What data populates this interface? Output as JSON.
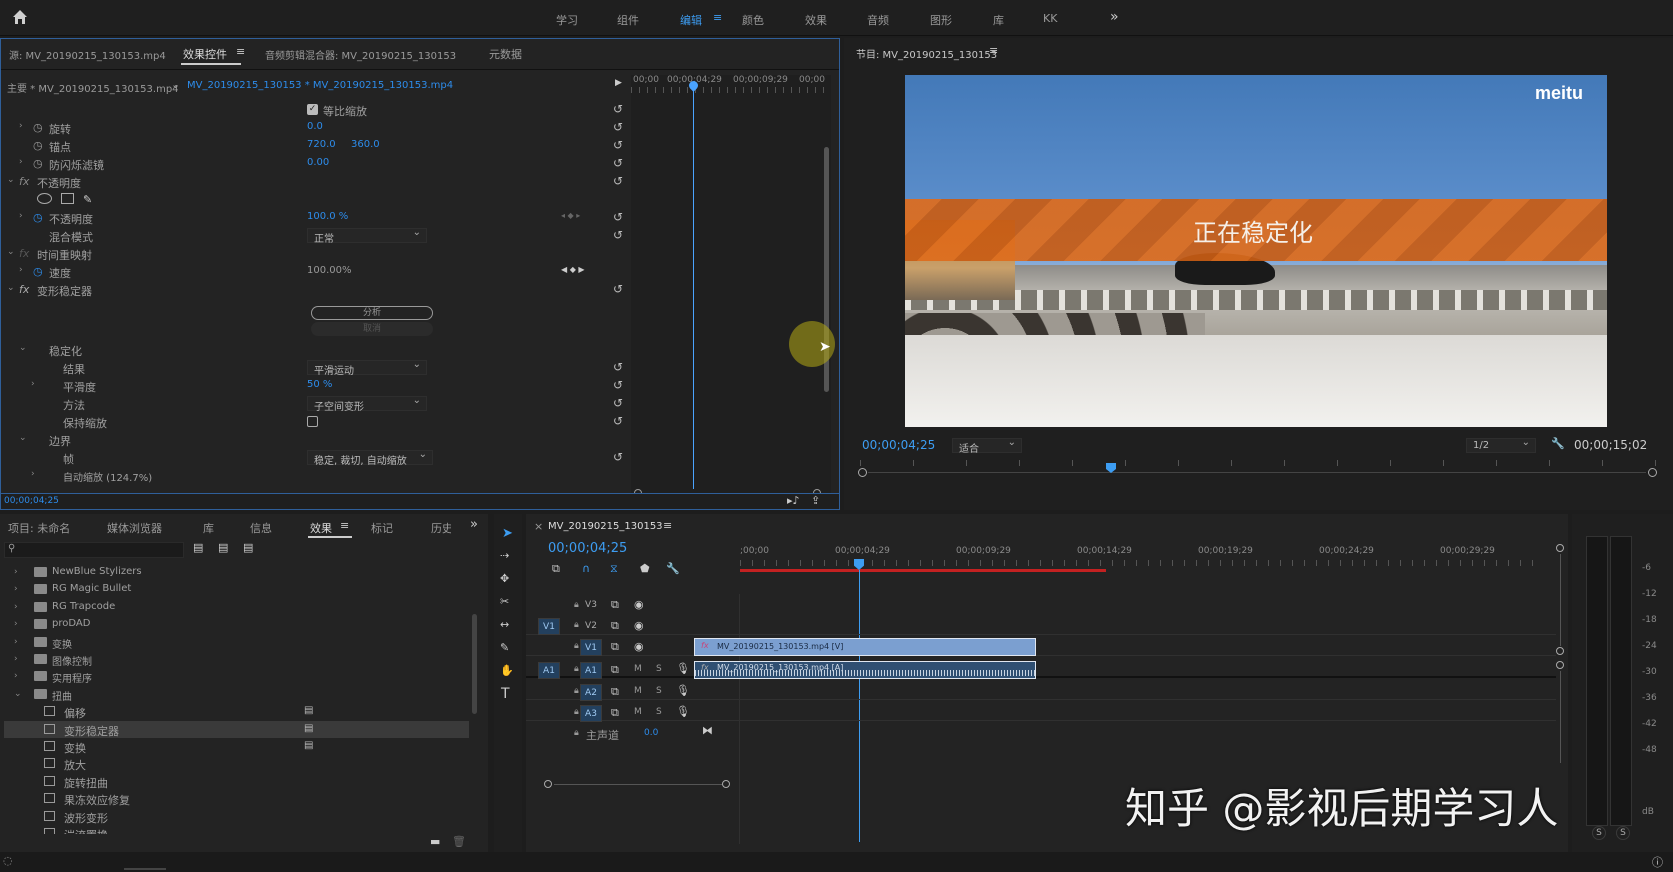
{
  "topbar": {
    "tabs": [
      "学习",
      "组件",
      "编辑",
      "颜色",
      "效果",
      "音频",
      "图形",
      "库",
      "KK"
    ],
    "active": "编辑",
    "more": "»"
  },
  "source_panel": {
    "tabs": [
      "源: MV_20190215_130153.mp4",
      "效果控件",
      "音频剪辑混合器: MV_20190215_130153",
      "元数据"
    ],
    "active_tab": "效果控件",
    "clip_master": "主要 * MV_20190215_130153.mp4",
    "clip_seq": "MV_20190215_130153 * MV_20190215_130153.mp4",
    "ruler": [
      "00;00",
      "00;00;04;29",
      "00;00;09;29",
      "00;00"
    ],
    "rows": {
      "uniform_scale": "等比缩放",
      "rotation": "旋转",
      "rotation_val": "0.0",
      "anchor": "锚点",
      "anchor_x": "720.0",
      "anchor_y": "360.0",
      "flicker": "防闪烁滤镜",
      "flicker_val": "0.00",
      "opacity_group": "不透明度",
      "opacity": "不透明度",
      "opacity_val": "100.0 %",
      "blend": "混合模式",
      "blend_val": "正常",
      "time_remap": "时间重映射",
      "speed": "速度",
      "speed_val": "100.00%",
      "warp": "变形稳定器",
      "analyze": "分析",
      "cancel": "取消",
      "stabilize": "稳定化",
      "result": "结果",
      "result_val": "平滑运动",
      "smoothness": "平滑度",
      "smoothness_val": "50 %",
      "method": "方法",
      "method_val": "子空间变形",
      "preserve": "保持缩放",
      "border": "边界",
      "framing": "帧",
      "framing_val": "稳定, 裁切, 自动缩放",
      "autoscale": "自动缩放 (124.7%)"
    },
    "timecode": "00;00;04;25"
  },
  "program": {
    "title": "节目: MV_20190215_130153",
    "logo": "meitu",
    "banner": "正在稳定化",
    "timecode": "00;00;04;25",
    "fit": "适合",
    "quality": "1/2",
    "duration": "00;00;15;02"
  },
  "project": {
    "tabs": [
      "项目: 未命名",
      "媒体浏览器",
      "库",
      "信息",
      "效果",
      "标记",
      "历史"
    ],
    "active_tab": "效果",
    "items": [
      {
        "name": "NewBlue Stylizers",
        "type": "folder"
      },
      {
        "name": "RG Magic Bullet",
        "type": "folder"
      },
      {
        "name": "RG Trapcode",
        "type": "folder"
      },
      {
        "name": "proDAD",
        "type": "folder"
      },
      {
        "name": "变换",
        "type": "folder"
      },
      {
        "name": "图像控制",
        "type": "folder"
      },
      {
        "name": "实用程序",
        "type": "folder"
      },
      {
        "name": "扭曲",
        "type": "folder",
        "open": true
      },
      {
        "name": "偏移",
        "type": "effect",
        "accel": true
      },
      {
        "name": "变形稳定器",
        "type": "effect",
        "accel": true,
        "selected": true
      },
      {
        "name": "变换",
        "type": "effect",
        "accel": true
      },
      {
        "name": "放大",
        "type": "effect"
      },
      {
        "name": "旋转扭曲",
        "type": "effect"
      },
      {
        "name": "果冻效应修复",
        "type": "effect"
      },
      {
        "name": "波形变形",
        "type": "effect"
      },
      {
        "name": "湍流置换",
        "type": "effect"
      }
    ]
  },
  "timeline": {
    "title": "MV_20190215_130153",
    "timecode": "00;00;04;25",
    "ruler": [
      ";00;00",
      "00;00;04;29",
      "00;00;09;29",
      "00;00;14;29",
      "00;00;19;29",
      "00;00;24;29",
      "00;00;29;29"
    ],
    "tracks": [
      "V3",
      "V2",
      "V1",
      "A1",
      "A2",
      "A3"
    ],
    "master": "主声道",
    "master_val": "0.0",
    "clip_v": "MV_20190215_130153.mp4 [V]",
    "clip_a": "MV_20190215_130153.mp4 [A]"
  },
  "meter": {
    "scale": [
      "-6",
      "-12",
      "-18",
      "-24",
      "-30",
      "-36",
      "-42",
      "-48",
      "dB"
    ],
    "s": "S"
  },
  "watermark": "知乎 @影视后期学习人"
}
